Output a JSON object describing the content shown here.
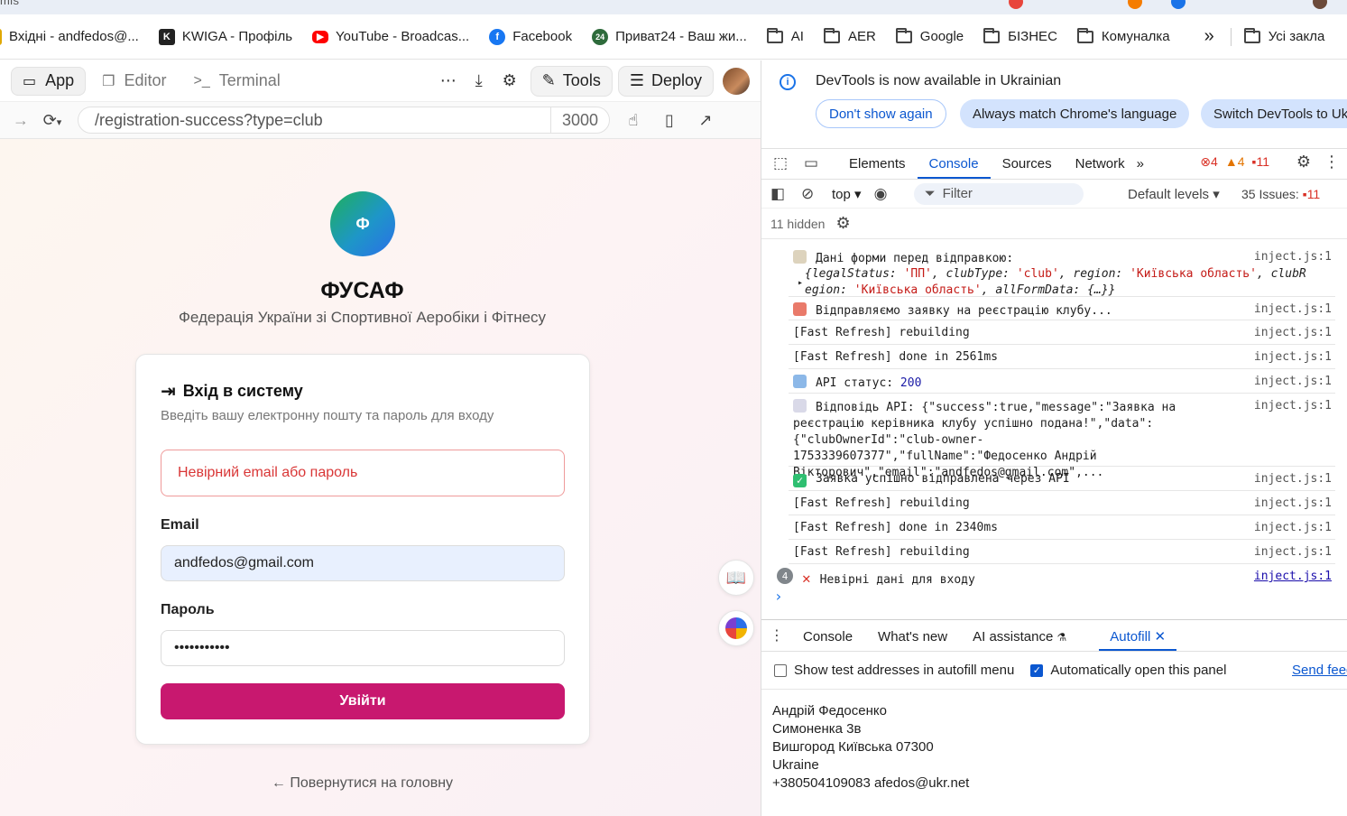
{
  "chrome": {
    "top_fragment": "mfs"
  },
  "bookmarks": [
    {
      "label": "Вхідні - andfedos@...",
      "icon": "gmail-icon",
      "color": "#e0a800"
    },
    {
      "label": "KWIGA - Профіль",
      "icon": "kwiga-icon",
      "color": "#222222"
    },
    {
      "label": "YouTube - Broadcas...",
      "icon": "youtube-icon",
      "color": "#ff0000"
    },
    {
      "label": "Facebook",
      "icon": "facebook-icon",
      "color": "#1877f2"
    },
    {
      "label": "Приват24 - Ваш жи...",
      "icon": "privat24-icon",
      "color": "#2e6b3b"
    },
    {
      "label": "AI",
      "icon": "folder-icon"
    },
    {
      "label": "AER",
      "icon": "folder-icon"
    },
    {
      "label": "Google",
      "icon": "folder-icon"
    },
    {
      "label": "БІЗНЕС",
      "icon": "folder-icon"
    },
    {
      "label": "Комуналка",
      "icon": "folder-icon"
    }
  ],
  "bookmarks_more": "»",
  "bookmarks_all": "Усі закла",
  "ide": {
    "tabs": {
      "app": "App",
      "editor": "Editor",
      "terminal": "Terminal"
    },
    "tools": "Tools",
    "deploy": "Deploy",
    "url_path": "/registration-success?type=club",
    "port": "3000"
  },
  "page": {
    "logo_letter": "Ф",
    "org_name": "ФУСАФ",
    "org_full": "Федерація України зі Спортивної Аеробіки і Фітнесу",
    "card_title": "Вхід в систему",
    "card_desc": "Введіть вашу електронну пошту та пароль для входу",
    "error": "Невірний email або пароль",
    "email_label": "Email",
    "email_value": "andfedos@gmail.com",
    "password_label": "Пароль",
    "password_value": "•••••••••••",
    "submit": "Увійти",
    "back": "← Повернутися на головну"
  },
  "devtools": {
    "info": "DevTools is now available in Ukrainian",
    "btn_dont_show": "Don't show again",
    "btn_match": "Always match Chrome's language",
    "btn_switch": "Switch DevTools to Uk",
    "tabs": [
      "Elements",
      "Console",
      "Sources",
      "Network"
    ],
    "active_tab": "Console",
    "errors": "4",
    "warnings": "4",
    "issues_badge": "11",
    "context": "top ▾",
    "filter": "Filter",
    "levels": "Default levels ▾",
    "issues_label": "35 Issues:",
    "issues_count": "11",
    "hidden": "11 hidden",
    "source": "inject.js:1",
    "logs": {
      "l1_title": "Дані форми перед відправкою:",
      "l1_obj_a": "{legalStatus: ",
      "l1_s1": "'ПП'",
      "l1_obj_b": ", clubType: ",
      "l1_s2": "'club'",
      "l1_obj_c": ", region: ",
      "l1_s3": "'Київська область'",
      "l1_obj_d": ", clubR",
      "l1_obj_e": "egion: ",
      "l1_s4": "'Київська область'",
      "l1_obj_f": ", allFormData: {…}}",
      "l2": "Відправляємо заявку на реєстрацію клубу...",
      "l3": "[Fast Refresh] rebuilding",
      "l4": "[Fast Refresh] done in 2561ms",
      "l5_label": "API статус: ",
      "l5_value": "200",
      "l6": "Відповідь API: {\"success\":true,\"message\":\"Заявка на реєстрацію керівника клубу успішно подана!\",\"data\":{\"clubOwnerId\":\"club-owner-1753339607377\",\"fullName\":\"Федосенко Андрій Вікторович\",\"email\":\"andfedos@gmail.com\",...",
      "l7": "Заявка успішно відправлена через API",
      "l8": "[Fast Refresh] rebuilding",
      "l9": "[Fast Refresh] done in 2340ms",
      "l10": "[Fast Refresh] rebuilding",
      "l11_count": "4",
      "l11": "Невірні дані для входу"
    },
    "drawer_tabs": [
      "Console",
      "What's new",
      "AI assistance",
      "Autofill"
    ],
    "drawer_active": "Autofill",
    "opt_show_test": "Show test addresses in autofill menu",
    "opt_auto_open": "Automatically open this panel",
    "send_feedback": "Send feed",
    "address": {
      "name": "Андрій Федосенко",
      "street": "Симоненка 3в",
      "city": "Вишгород Київська 07300",
      "country": "Ukraine",
      "contact": "+380504109083 afedos@ukr.net"
    }
  }
}
